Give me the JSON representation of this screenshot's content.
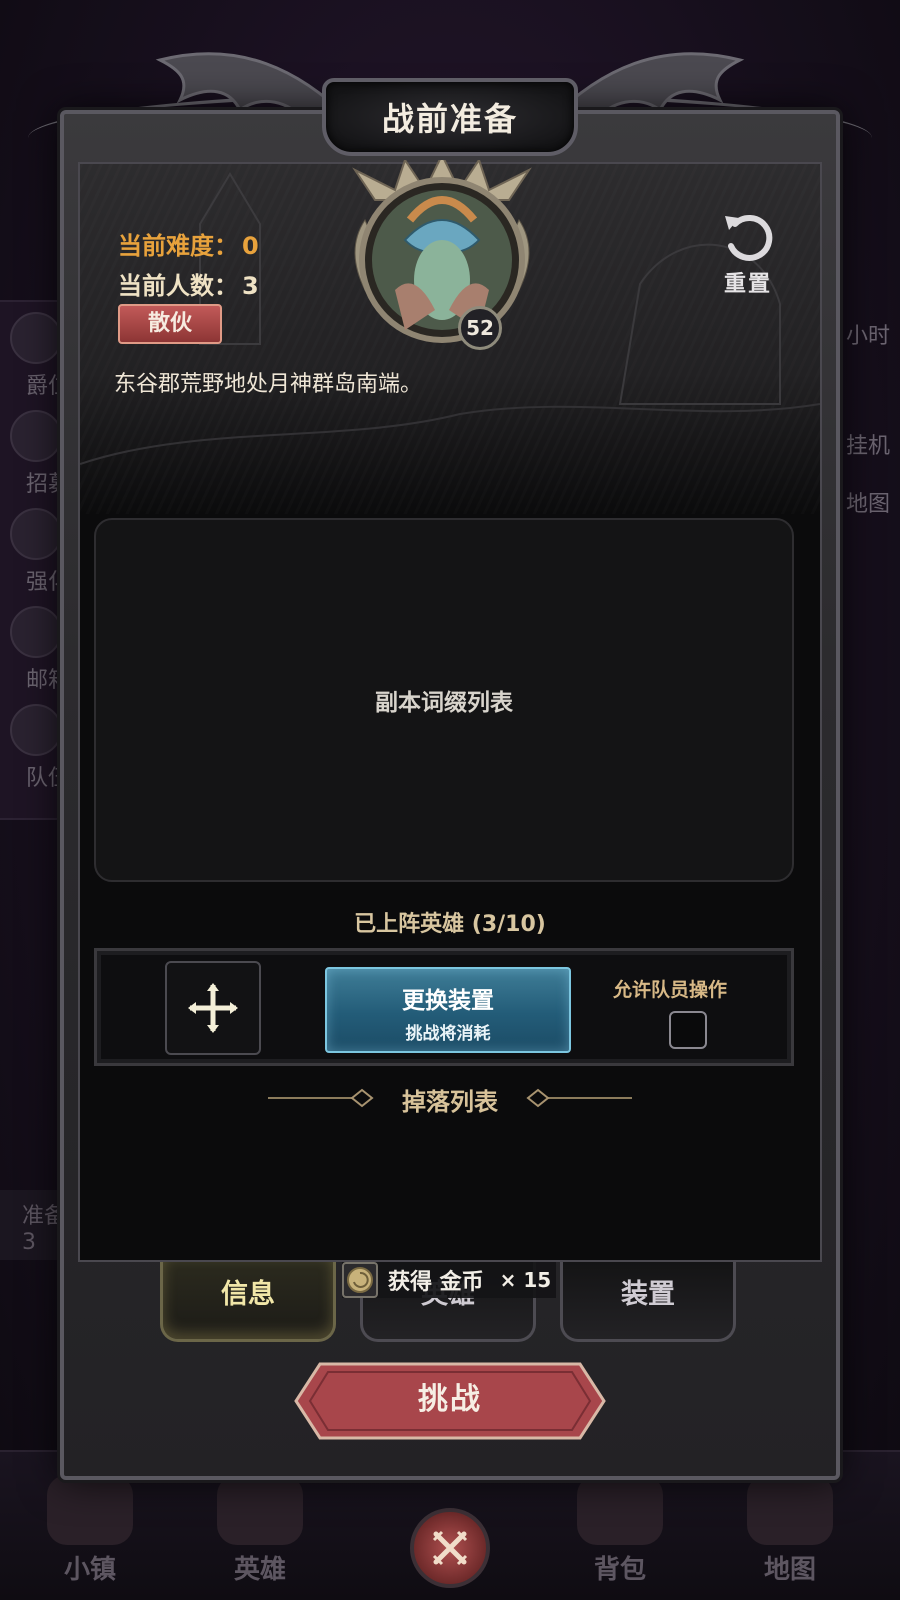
{
  "background": {
    "side_menu": [
      "爵位",
      "招募",
      "强化",
      "邮箱",
      "队伍"
    ],
    "right_menu": [
      "小时",
      "挂机",
      "地图"
    ],
    "ready_label": "准备",
    "ready_count": "3",
    "bottom_nav": [
      "小镇",
      "英雄",
      "背包",
      "地图"
    ]
  },
  "modal": {
    "title": "战前准备",
    "difficulty_label": "当前难度：",
    "difficulty_value": "0",
    "count_label": "当前人数：",
    "count_value": "3",
    "party_type": "散伙",
    "hero_level": "52",
    "reset_label": "重置",
    "zone_description": "东谷郡荒野地处月神群岛南端。",
    "affix_list_label": "副本词缀列表",
    "heroes_deployed": "已上阵英雄 (3/10)",
    "change_gear_title": "更换装置",
    "change_gear_subtitle": "挑战将消耗",
    "allow_member_ops_label": "允许队员操作",
    "allow_member_ops_checked": false,
    "drop_list_label": "掉落列表",
    "tabs": [
      "信息",
      "英雄",
      "装置"
    ],
    "active_tab": "信息",
    "reward_text": "获得 金币",
    "reward_quantity": "× 15",
    "challenge_label": "挑战"
  },
  "colors": {
    "difficulty": "#e8a23c",
    "party_badge": "#b04848",
    "change_gear_button": "#2e6f8c",
    "challenge_button": "#a8464b",
    "active_tab": "#f1e7a8"
  },
  "icons": [
    "move-cross-icon",
    "reset-arrow-icon",
    "gold-coin-icon",
    "crossed-swords-icon"
  ]
}
